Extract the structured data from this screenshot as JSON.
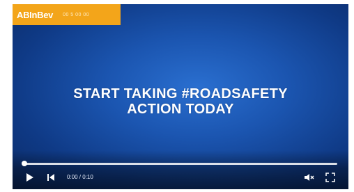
{
  "logo": {
    "brand": "ABInBev",
    "sub": "00 5 00 00"
  },
  "headline": {
    "line1": "START TAKING #ROADSAFETY",
    "line2": "ACTION TODAY"
  },
  "player": {
    "progress": 0.0,
    "time": "0:00 / 0:10"
  },
  "icons": {
    "play": "play-icon",
    "skip": "skip-back-icon",
    "volume": "volume-muted-icon",
    "fullscreen": "fullscreen-icon"
  },
  "colors": {
    "logo_bg": "#f3a51a",
    "video_bg": "#1b55b0"
  }
}
